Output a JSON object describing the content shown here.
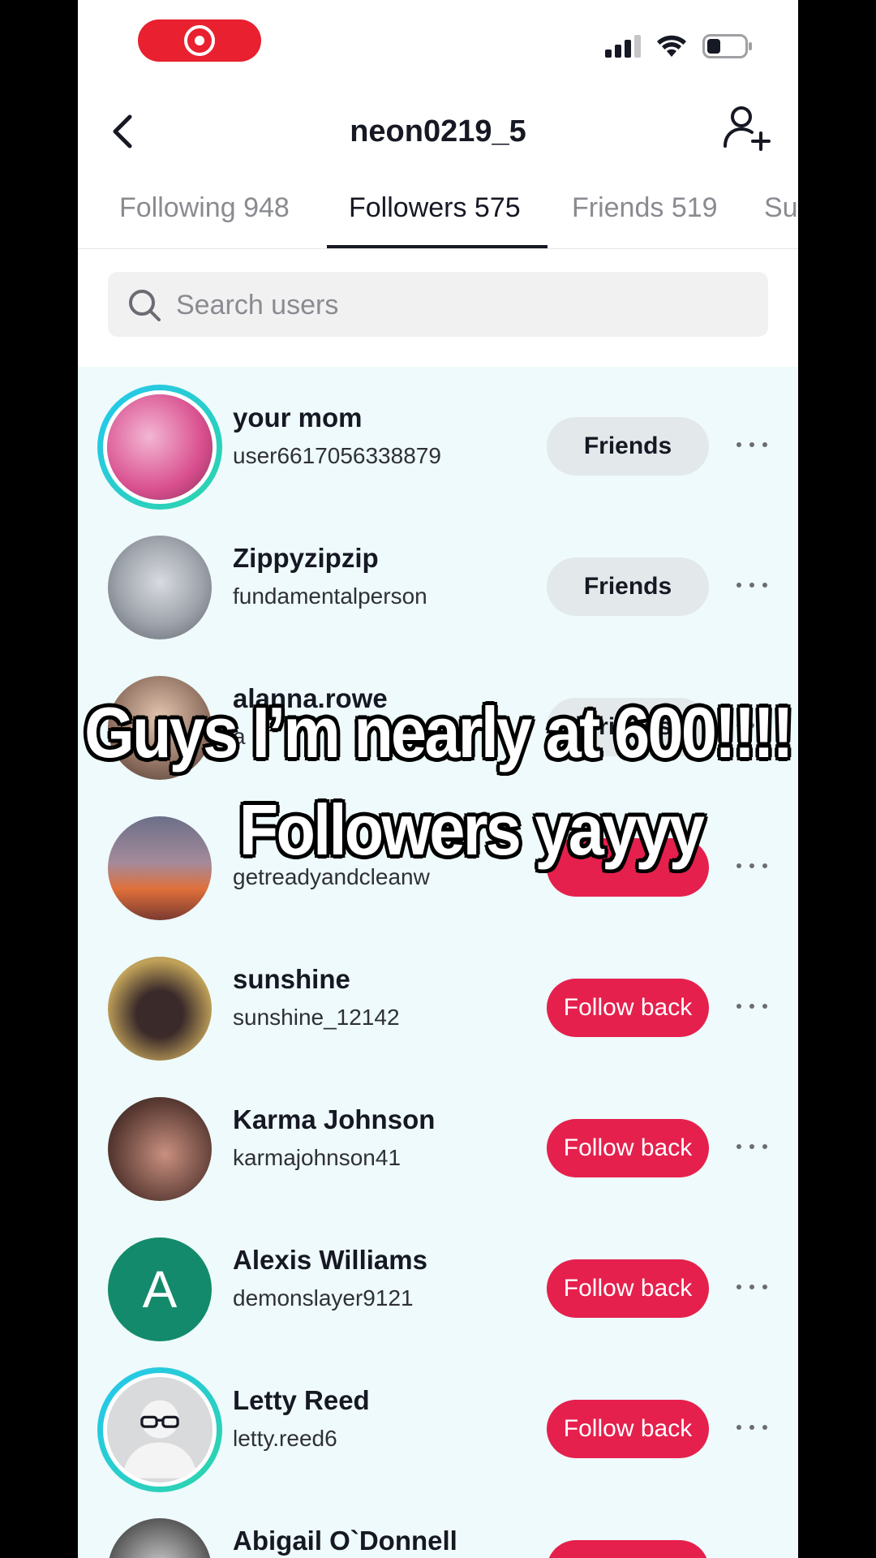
{
  "profile": {
    "username": "neon0219_5"
  },
  "tabs": [
    {
      "label": "Following 948"
    },
    {
      "label": "Followers 575"
    },
    {
      "label": "Friends 519"
    },
    {
      "label": "Su"
    }
  ],
  "search": {
    "placeholder": "Search users"
  },
  "followers": [
    {
      "name": "your mom",
      "handle": "user6617056338879",
      "button": "Friends"
    },
    {
      "name": "Zippyzipzip",
      "handle": "fundamentalperson",
      "button": "Friends"
    },
    {
      "name": "alanna.rowe",
      "handle": "a",
      "button": "Friends"
    },
    {
      "name": "",
      "handle": "getreadyandcleanw",
      "button": ""
    },
    {
      "name": "sunshine",
      "handle": "sunshine_12142",
      "button": "Follow back"
    },
    {
      "name": "Karma Johnson",
      "handle": "karmajohnson41",
      "button": "Follow back"
    },
    {
      "name": "Alexis Williams",
      "handle": "demonslayer9121",
      "button": "Follow back",
      "avatar_letter": "A"
    },
    {
      "name": "Letty Reed",
      "handle": "letty.reed6",
      "button": "Follow back"
    },
    {
      "name": "Abigail O`Donnell",
      "handle": "",
      "button": "Follow back"
    }
  ],
  "overlay": {
    "line1": "Guys I’m nearly at 600!!!!",
    "line2": "Followers yayyy"
  },
  "colors": {
    "follow_back": "#e5204d",
    "friends_button": "#e3e8ea",
    "story_ring": "#25c7f0",
    "record": "#e8202f"
  }
}
